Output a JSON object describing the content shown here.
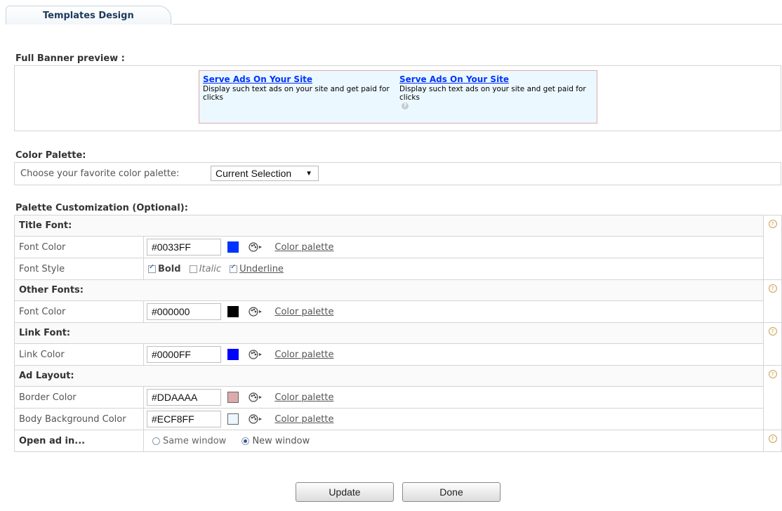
{
  "tab": {
    "label": "Templates Design"
  },
  "preview": {
    "title": "Full Banner preview :",
    "ads": [
      {
        "title": "Serve Ads On Your Site",
        "body": "Display such text ads on your site and get paid for clicks"
      },
      {
        "title": "Serve Ads On Your Site",
        "body": "Display such text ads on your site and get paid for clicks"
      }
    ]
  },
  "palette": {
    "title": "Color Palette:",
    "label": "Choose your favorite color palette:",
    "selected": "Current Selection"
  },
  "customization": {
    "title": "Palette Customization (Optional):",
    "title_font": {
      "heading": "Title Font:",
      "color_label": "Font Color",
      "color_value": "#0033FF",
      "style_label": "Font Style",
      "bold": "Bold",
      "italic": "Italic",
      "underline": "Underline",
      "bold_checked": true,
      "italic_checked": false,
      "underline_checked": true
    },
    "other_fonts": {
      "heading": "Other Fonts:",
      "color_label": "Font Color",
      "color_value": "#000000"
    },
    "link_font": {
      "heading": "Link Font:",
      "color_label": "Link Color",
      "color_value": "#0000FF"
    },
    "ad_layout": {
      "heading": "Ad Layout:",
      "border_label": "Border Color",
      "border_value": "#DDAAAA",
      "bg_label": "Body Background Color",
      "bg_value": "#ECF8FF"
    },
    "open_ad": {
      "heading": "Open ad in...",
      "same": "Same window",
      "new": "New window",
      "selected": "New window"
    },
    "color_palette_link": "Color palette"
  },
  "buttons": {
    "update": "Update",
    "done": "Done"
  }
}
